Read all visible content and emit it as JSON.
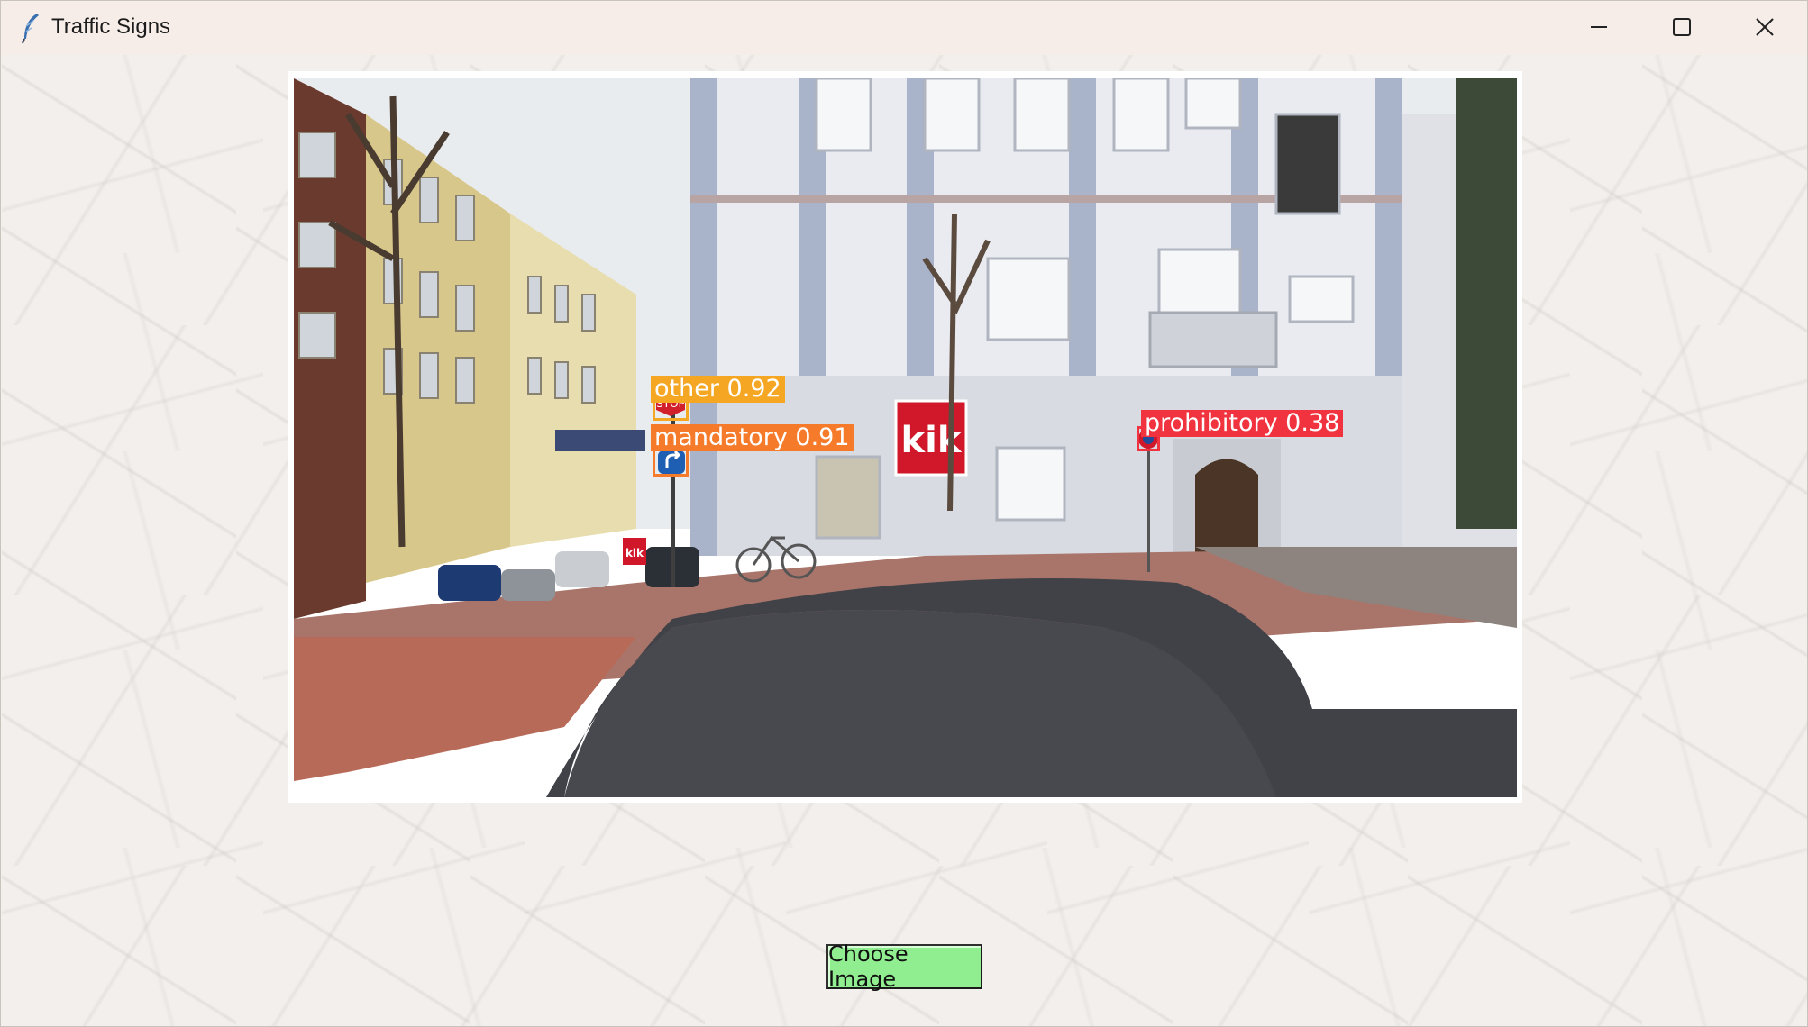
{
  "window": {
    "title": "Traffic Signs",
    "icon": "feather-icon",
    "controls": [
      "minimize-icon",
      "maximize-icon",
      "close-icon"
    ]
  },
  "image": {
    "scene_text": {
      "stop_sign": "STOP",
      "store_sign": "kik",
      "store_small_sign": "kik"
    },
    "detections": [
      {
        "label": "other 0.92",
        "color": "#f5a623"
      },
      {
        "label": "mandatory 0.91",
        "color": "#f57a2a"
      },
      {
        "label": "prohibitory 0.38",
        "color": "#f0333f"
      }
    ]
  },
  "controls": {
    "choose_button": "Choose Image"
  },
  "colors": {
    "button_bg": "#90ee90",
    "window_bg": "#f2efec"
  }
}
